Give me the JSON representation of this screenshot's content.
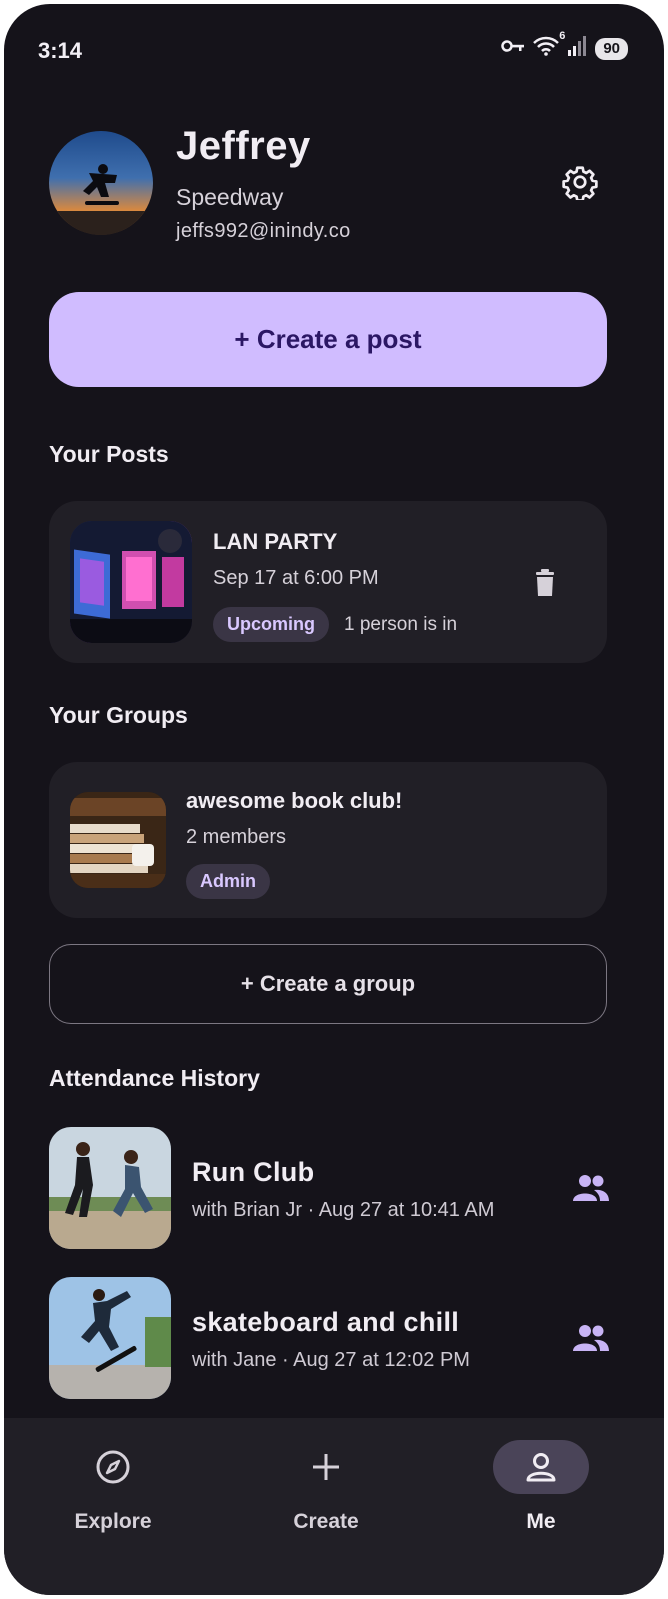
{
  "status_bar": {
    "time": "3:14",
    "battery": "90",
    "signal_badge": "6"
  },
  "profile": {
    "name": "Jeffrey",
    "location": "Speedway",
    "email": "jeffs992@inindy.co"
  },
  "create_post_label": "+ Create a post",
  "your_posts": {
    "title": "Your Posts",
    "items": [
      {
        "title": "LAN PARTY",
        "date": "Sep 17 at 6:00 PM",
        "status": "Upcoming",
        "attendance": "1 person is in"
      }
    ]
  },
  "your_groups": {
    "title": "Your Groups",
    "items": [
      {
        "title": "awesome book club!",
        "members": "2 members",
        "role": "Admin"
      }
    ]
  },
  "create_group_label": "+ Create a group",
  "attendance_history": {
    "title": "Attendance History",
    "items": [
      {
        "title": "Run Club",
        "subtitle": "with Brian Jr · Aug 27 at 10:41 AM"
      },
      {
        "title": "skateboard and chill",
        "subtitle": "with Jane · Aug 27 at 12:02 PM"
      }
    ]
  },
  "nav": {
    "items": [
      {
        "label": "Explore",
        "icon": "compass-icon"
      },
      {
        "label": "Create",
        "icon": "plus-icon"
      },
      {
        "label": "Me",
        "icon": "person-icon",
        "active": true
      }
    ]
  },
  "colors": {
    "background": "#15131a",
    "card": "#211f26",
    "accent": "#d0bcff",
    "accent_text": "#2b1764"
  }
}
